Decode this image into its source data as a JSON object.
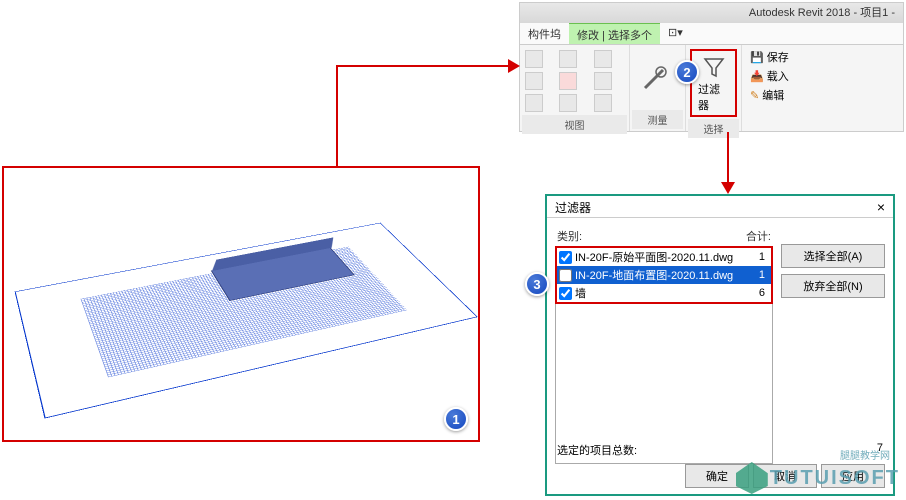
{
  "app_title": "Autodesk Revit 2018 -  项目1 -",
  "tabs": {
    "t1": "构件坞",
    "t2": "修改 | 选择多个",
    "t3": "⊡▾"
  },
  "ribbon": {
    "group_view": "视图",
    "group_measure": "测量",
    "group_select": "选择",
    "filter_label": "过滤器",
    "save": "保存",
    "load": "载入",
    "edit": "编辑"
  },
  "dialog": {
    "title": "过滤器",
    "col_category": "类别:",
    "col_total": "合计:",
    "rows": [
      {
        "name": "IN-20F-原始平面图-2020.11.dwg",
        "count": "1",
        "checked": true
      },
      {
        "name": "IN-20F-地面布置图-2020.11.dwg",
        "count": "1",
        "checked": false
      },
      {
        "name": "墙",
        "count": "6",
        "checked": true
      }
    ],
    "select_all": "选择全部(A)",
    "discard_all": "放弃全部(N)",
    "selected_total_label": "选定的项目总数:",
    "selected_total_value": "7",
    "ok": "确定",
    "cancel": "取消",
    "apply": "应用"
  },
  "badges": {
    "b1": "1",
    "b2": "2",
    "b3": "3"
  },
  "watermark": {
    "main": "TUTUISOFT",
    "sub": "腿腿教学网"
  }
}
